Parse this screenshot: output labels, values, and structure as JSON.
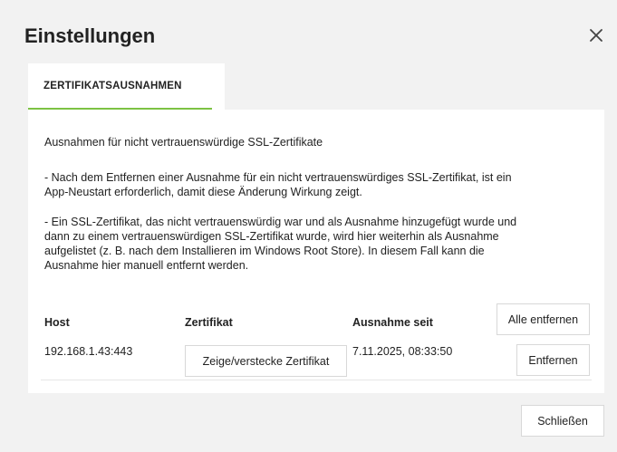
{
  "dialog": {
    "title": "Einstellungen",
    "close_icon": "close-icon"
  },
  "tabs": [
    {
      "label": "ZERTIFIKATSAUSNAHMEN",
      "active": true
    }
  ],
  "colors": {
    "accent": "#7cc243",
    "background": "#f2f2f2",
    "panel": "#ffffff"
  },
  "content": {
    "heading": "Ausnahmen für nicht vertrauenswürdige SSL-Zertifikate",
    "note1_line1": "- Nach dem Entfernen einer Ausnahme für ein nicht vertrauenswürdiges SSL-Zertifikat, ist ein",
    "note1_line2": "App-Neustart erforderlich, damit diese Änderung Wirkung zeigt.",
    "note2_line1": "- Ein SSL-Zertifikat, das nicht vertrauenswürdig war und als Ausnahme hinzugefügt wurde und",
    "note2_line2": "dann zu einem vertrauenswürdigen SSL-Zertifikat wurde, wird hier weiterhin als Ausnahme",
    "note2_line3": "aufgelistet (z. B. nach dem Installieren im Windows Root Store). In diesem Fall kann die",
    "note2_line4": "Ausnahme hier manuell entfernt werden."
  },
  "table": {
    "columns": [
      "Host",
      "Zertifikat",
      "Ausnahme seit"
    ],
    "remove_all_label": "Alle entfernen",
    "rows": [
      {
        "host": "192.168.1.43:443",
        "certificate_button": "Zeige/verstecke Zertifikat",
        "since": "7.11.2025, 08:33:50",
        "remove_label": "Entfernen"
      }
    ]
  },
  "footer": {
    "close_label": "Schließen"
  }
}
